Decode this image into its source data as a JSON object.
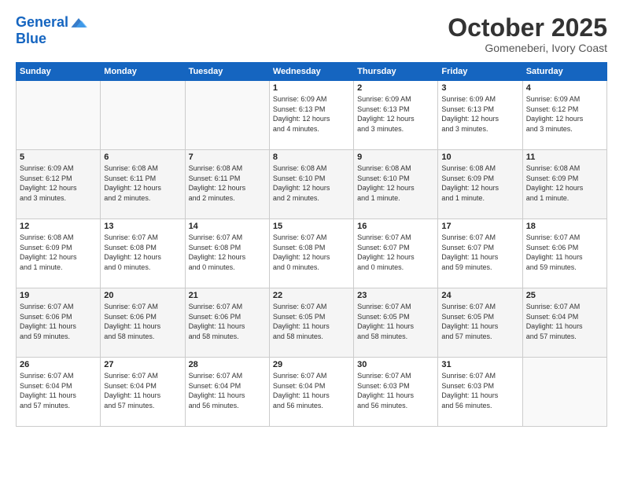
{
  "header": {
    "logo_line1": "General",
    "logo_line2": "Blue",
    "month": "October 2025",
    "location": "Gomeneberi, Ivory Coast"
  },
  "weekdays": [
    "Sunday",
    "Monday",
    "Tuesday",
    "Wednesday",
    "Thursday",
    "Friday",
    "Saturday"
  ],
  "weeks": [
    [
      {
        "day": "",
        "text": ""
      },
      {
        "day": "",
        "text": ""
      },
      {
        "day": "",
        "text": ""
      },
      {
        "day": "1",
        "text": "Sunrise: 6:09 AM\nSunset: 6:13 PM\nDaylight: 12 hours\nand 4 minutes."
      },
      {
        "day": "2",
        "text": "Sunrise: 6:09 AM\nSunset: 6:13 PM\nDaylight: 12 hours\nand 3 minutes."
      },
      {
        "day": "3",
        "text": "Sunrise: 6:09 AM\nSunset: 6:13 PM\nDaylight: 12 hours\nand 3 minutes."
      },
      {
        "day": "4",
        "text": "Sunrise: 6:09 AM\nSunset: 6:12 PM\nDaylight: 12 hours\nand 3 minutes."
      }
    ],
    [
      {
        "day": "5",
        "text": "Sunrise: 6:09 AM\nSunset: 6:12 PM\nDaylight: 12 hours\nand 3 minutes."
      },
      {
        "day": "6",
        "text": "Sunrise: 6:08 AM\nSunset: 6:11 PM\nDaylight: 12 hours\nand 2 minutes."
      },
      {
        "day": "7",
        "text": "Sunrise: 6:08 AM\nSunset: 6:11 PM\nDaylight: 12 hours\nand 2 minutes."
      },
      {
        "day": "8",
        "text": "Sunrise: 6:08 AM\nSunset: 6:10 PM\nDaylight: 12 hours\nand 2 minutes."
      },
      {
        "day": "9",
        "text": "Sunrise: 6:08 AM\nSunset: 6:10 PM\nDaylight: 12 hours\nand 1 minute."
      },
      {
        "day": "10",
        "text": "Sunrise: 6:08 AM\nSunset: 6:09 PM\nDaylight: 12 hours\nand 1 minute."
      },
      {
        "day": "11",
        "text": "Sunrise: 6:08 AM\nSunset: 6:09 PM\nDaylight: 12 hours\nand 1 minute."
      }
    ],
    [
      {
        "day": "12",
        "text": "Sunrise: 6:08 AM\nSunset: 6:09 PM\nDaylight: 12 hours\nand 1 minute."
      },
      {
        "day": "13",
        "text": "Sunrise: 6:07 AM\nSunset: 6:08 PM\nDaylight: 12 hours\nand 0 minutes."
      },
      {
        "day": "14",
        "text": "Sunrise: 6:07 AM\nSunset: 6:08 PM\nDaylight: 12 hours\nand 0 minutes."
      },
      {
        "day": "15",
        "text": "Sunrise: 6:07 AM\nSunset: 6:08 PM\nDaylight: 12 hours\nand 0 minutes."
      },
      {
        "day": "16",
        "text": "Sunrise: 6:07 AM\nSunset: 6:07 PM\nDaylight: 12 hours\nand 0 minutes."
      },
      {
        "day": "17",
        "text": "Sunrise: 6:07 AM\nSunset: 6:07 PM\nDaylight: 11 hours\nand 59 minutes."
      },
      {
        "day": "18",
        "text": "Sunrise: 6:07 AM\nSunset: 6:06 PM\nDaylight: 11 hours\nand 59 minutes."
      }
    ],
    [
      {
        "day": "19",
        "text": "Sunrise: 6:07 AM\nSunset: 6:06 PM\nDaylight: 11 hours\nand 59 minutes."
      },
      {
        "day": "20",
        "text": "Sunrise: 6:07 AM\nSunset: 6:06 PM\nDaylight: 11 hours\nand 58 minutes."
      },
      {
        "day": "21",
        "text": "Sunrise: 6:07 AM\nSunset: 6:06 PM\nDaylight: 11 hours\nand 58 minutes."
      },
      {
        "day": "22",
        "text": "Sunrise: 6:07 AM\nSunset: 6:05 PM\nDaylight: 11 hours\nand 58 minutes."
      },
      {
        "day": "23",
        "text": "Sunrise: 6:07 AM\nSunset: 6:05 PM\nDaylight: 11 hours\nand 58 minutes."
      },
      {
        "day": "24",
        "text": "Sunrise: 6:07 AM\nSunset: 6:05 PM\nDaylight: 11 hours\nand 57 minutes."
      },
      {
        "day": "25",
        "text": "Sunrise: 6:07 AM\nSunset: 6:04 PM\nDaylight: 11 hours\nand 57 minutes."
      }
    ],
    [
      {
        "day": "26",
        "text": "Sunrise: 6:07 AM\nSunset: 6:04 PM\nDaylight: 11 hours\nand 57 minutes."
      },
      {
        "day": "27",
        "text": "Sunrise: 6:07 AM\nSunset: 6:04 PM\nDaylight: 11 hours\nand 57 minutes."
      },
      {
        "day": "28",
        "text": "Sunrise: 6:07 AM\nSunset: 6:04 PM\nDaylight: 11 hours\nand 56 minutes."
      },
      {
        "day": "29",
        "text": "Sunrise: 6:07 AM\nSunset: 6:04 PM\nDaylight: 11 hours\nand 56 minutes."
      },
      {
        "day": "30",
        "text": "Sunrise: 6:07 AM\nSunset: 6:03 PM\nDaylight: 11 hours\nand 56 minutes."
      },
      {
        "day": "31",
        "text": "Sunrise: 6:07 AM\nSunset: 6:03 PM\nDaylight: 11 hours\nand 56 minutes."
      },
      {
        "day": "",
        "text": ""
      }
    ]
  ]
}
